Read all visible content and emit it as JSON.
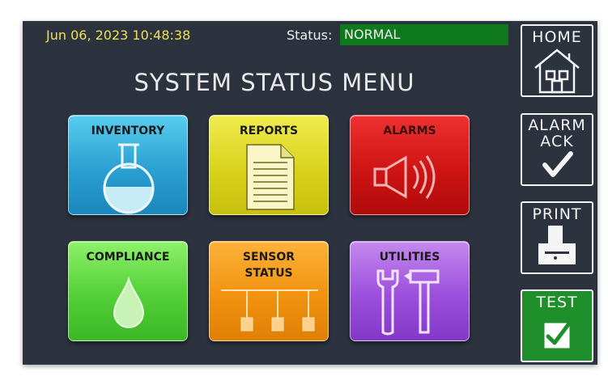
{
  "header": {
    "datetime": "Jun 06, 2023 10:48:38",
    "status_label": "Status:",
    "status_value": "NORMAL"
  },
  "menu": {
    "title": "SYSTEM STATUS MENU",
    "tiles": [
      {
        "label": "INVENTORY",
        "color": "#2a9fd2",
        "icon": "flask-icon"
      },
      {
        "label": "REPORTS",
        "color": "#d9d21c",
        "icon": "document-icon"
      },
      {
        "label": "ALARMS",
        "color": "#cf1414",
        "icon": "speaker-icon"
      },
      {
        "label": "COMPLIANCE",
        "color": "#52cf36",
        "icon": "droplet-icon"
      },
      {
        "label_line1": "SENSOR",
        "label_line2": "STATUS",
        "color": "#f2920f",
        "icon": "sensor-network-icon"
      },
      {
        "label": "UTILITIES",
        "color": "#9c4fdb",
        "icon": "tools-icon"
      }
    ]
  },
  "sidebar": {
    "home": {
      "label": "HOME",
      "icon": "house-icon"
    },
    "alarm_ack": {
      "label_line1": "ALARM",
      "label_line2": "ACK",
      "icon": "checkmark-icon"
    },
    "print": {
      "label": "PRINT",
      "icon": "printer-icon"
    },
    "test": {
      "label": "TEST",
      "icon": "checkbox-icon",
      "color": "#1f8f2c"
    }
  },
  "colors": {
    "panel_background": "#2c323e",
    "datetime_text": "#f2e04a",
    "status_normal": "#0f7a1d"
  }
}
